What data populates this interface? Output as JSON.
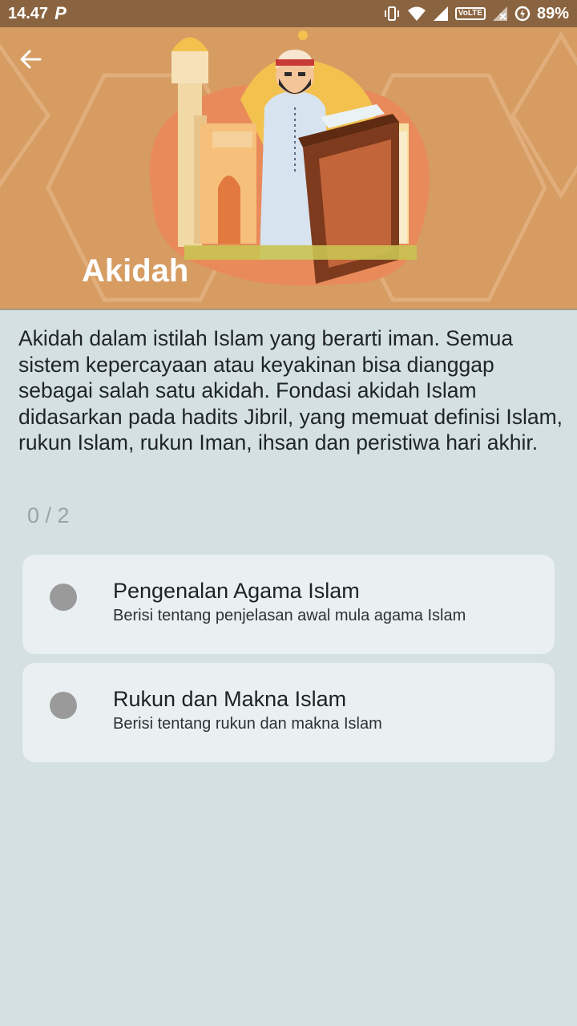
{
  "status_bar": {
    "time": "14.47",
    "notification_icon": "P",
    "volte": "VoLTE",
    "battery": "89%",
    "icons": [
      "vibrate-icon",
      "wifi-icon",
      "signal-icon",
      "volte-icon",
      "signal-no-data-icon",
      "data-saver-icon"
    ]
  },
  "header": {
    "title": "Akidah",
    "back_icon": "arrow-left-icon",
    "colors": {
      "background": "#d69c62",
      "title": "#ffffff"
    }
  },
  "content": {
    "description": "Akidah dalam istilah Islam yang berarti iman. Semua sistem kepercayaan atau keyakinan bisa dianggap sebagai salah satu akidah. Fondasi akidah Islam didasarkan pada hadits Jibril, yang memuat definisi Islam, rukun Islam, rukun Iman, ihsan dan peristiwa hari akhir.",
    "progress": "0 / 2"
  },
  "lessons": [
    {
      "title": "Pengenalan Agama Islam",
      "subtitle": "Berisi tentang penjelasan awal mula agama Islam"
    },
    {
      "title": "Rukun dan Makna Islam",
      "subtitle": "Berisi tentang rukun dan makna Islam"
    }
  ]
}
